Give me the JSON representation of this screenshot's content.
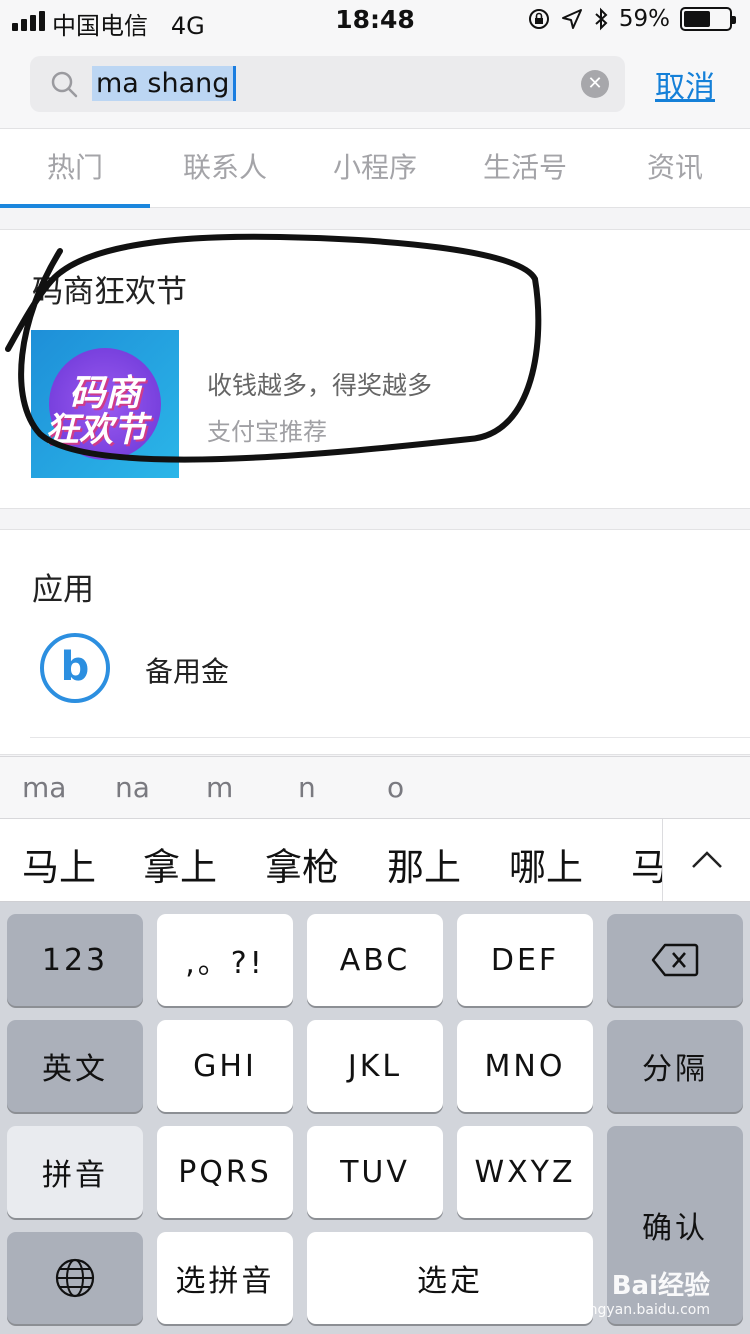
{
  "status_bar": {
    "carrier": "中国电信",
    "network": "4G",
    "time": "18:48",
    "battery_text": "59%",
    "battery_level": 0.59
  },
  "search": {
    "query": "ma shang",
    "cancel_label": "取消"
  },
  "tabs": [
    {
      "label": "热门",
      "active": true
    },
    {
      "label": "联系人"
    },
    {
      "label": "小程序"
    },
    {
      "label": "生活号"
    },
    {
      "label": "资讯"
    }
  ],
  "promo": {
    "title": "码商狂欢节",
    "thumb_text_1": "码商",
    "thumb_text_2": "狂欢节",
    "line1": "收钱越多，得奖越多",
    "line2": "支付宝推荐"
  },
  "apps_section": {
    "title": "应用",
    "items": [
      {
        "icon": "b-logo-icon",
        "name": "备用金"
      }
    ]
  },
  "pinyin_options": [
    "ma",
    "na",
    "m",
    "n",
    "o"
  ],
  "candidates": [
    "马上",
    "拿上",
    "拿枪",
    "那上",
    "哪上",
    "马"
  ],
  "keyboard": {
    "rows": [
      [
        "123",
        ",。?!",
        "ABC",
        "DEF"
      ],
      [
        "英文",
        "GHI",
        "JKL",
        "MNO",
        "分隔"
      ],
      [
        "拼音",
        "PQRS",
        "TUV",
        "WXYZ"
      ],
      [
        "选拼音",
        "选定"
      ]
    ],
    "confirm_label": "确认"
  },
  "watermark": {
    "brand": "Bai经验",
    "url": "jingyan.baidu.com"
  }
}
